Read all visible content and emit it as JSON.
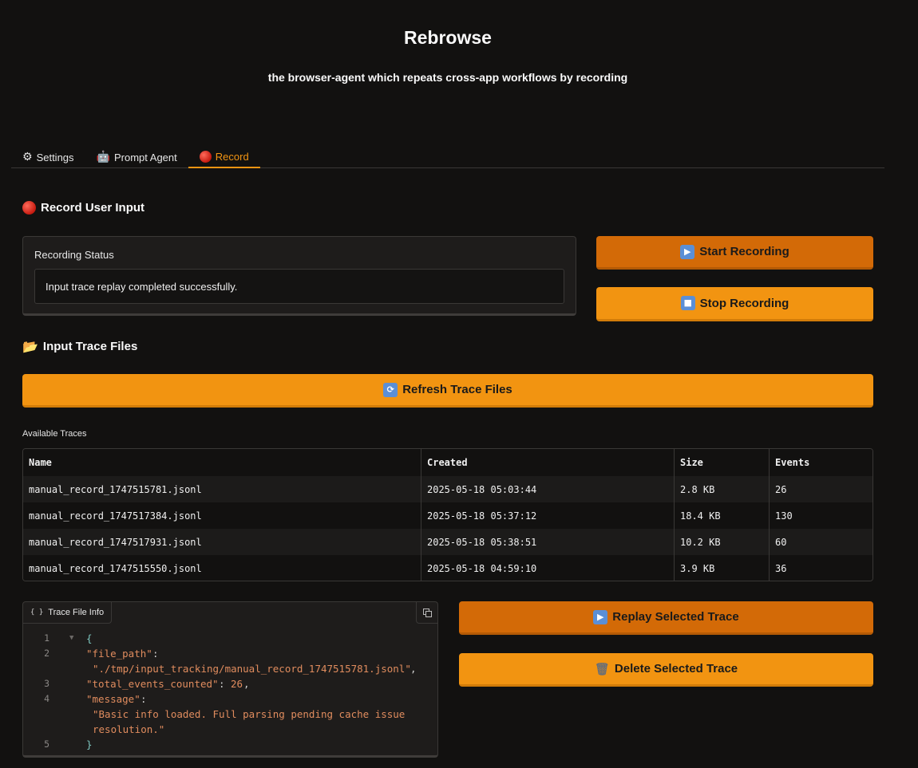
{
  "app": {
    "title": "Rebrowse",
    "subtitle": "the browser-agent which repeats cross-app workflows by recording"
  },
  "tabs": [
    {
      "label": "Settings",
      "icon": "gear-icon",
      "active": false
    },
    {
      "label": "Prompt Agent",
      "icon": "robot-icon",
      "active": false
    },
    {
      "label": "Record",
      "icon": "red-circle-icon",
      "active": true
    }
  ],
  "record": {
    "title": "Record User Input",
    "status_label": "Recording Status",
    "status_value": "Input trace replay completed successfully.",
    "start_label": "Start Recording",
    "stop_label": "Stop Recording"
  },
  "traces": {
    "title": "Input Trace Files",
    "refresh_label": "Refresh Trace Files",
    "available_label": "Available Traces",
    "columns": [
      "Name",
      "Created",
      "Size",
      "Events"
    ],
    "rows": [
      [
        "manual_record_1747515781.jsonl",
        "2025-05-18 05:03:44",
        "2.8 KB",
        "26"
      ],
      [
        "manual_record_1747517384.jsonl",
        "2025-05-18 05:37:12",
        "18.4 KB",
        "130"
      ],
      [
        "manual_record_1747517931.jsonl",
        "2025-05-18 05:38:51",
        "10.2 KB",
        "60"
      ],
      [
        "manual_record_1747515550.jsonl",
        "2025-05-18 04:59:10",
        "3.9 KB",
        "36"
      ]
    ]
  },
  "trace_info": {
    "label": "Trace File Info",
    "line_numbers": [
      "1",
      "2",
      "3",
      "4",
      "5"
    ],
    "open_brace": "{",
    "close_brace": "}",
    "file_path_key": "\"file_path\"",
    "file_path_value": "\"./tmp/input_tracking/manual_record_1747515781.jsonl\"",
    "events_key": "\"total_events_counted\"",
    "events_value": "26",
    "message_key": "\"message\"",
    "message_value_line1": "\"Basic info loaded. Full parsing pending cache issue",
    "message_value_line2": "resolution.\""
  },
  "actions": {
    "replay_label": "Replay Selected Trace",
    "delete_label": "Delete Selected Trace"
  }
}
